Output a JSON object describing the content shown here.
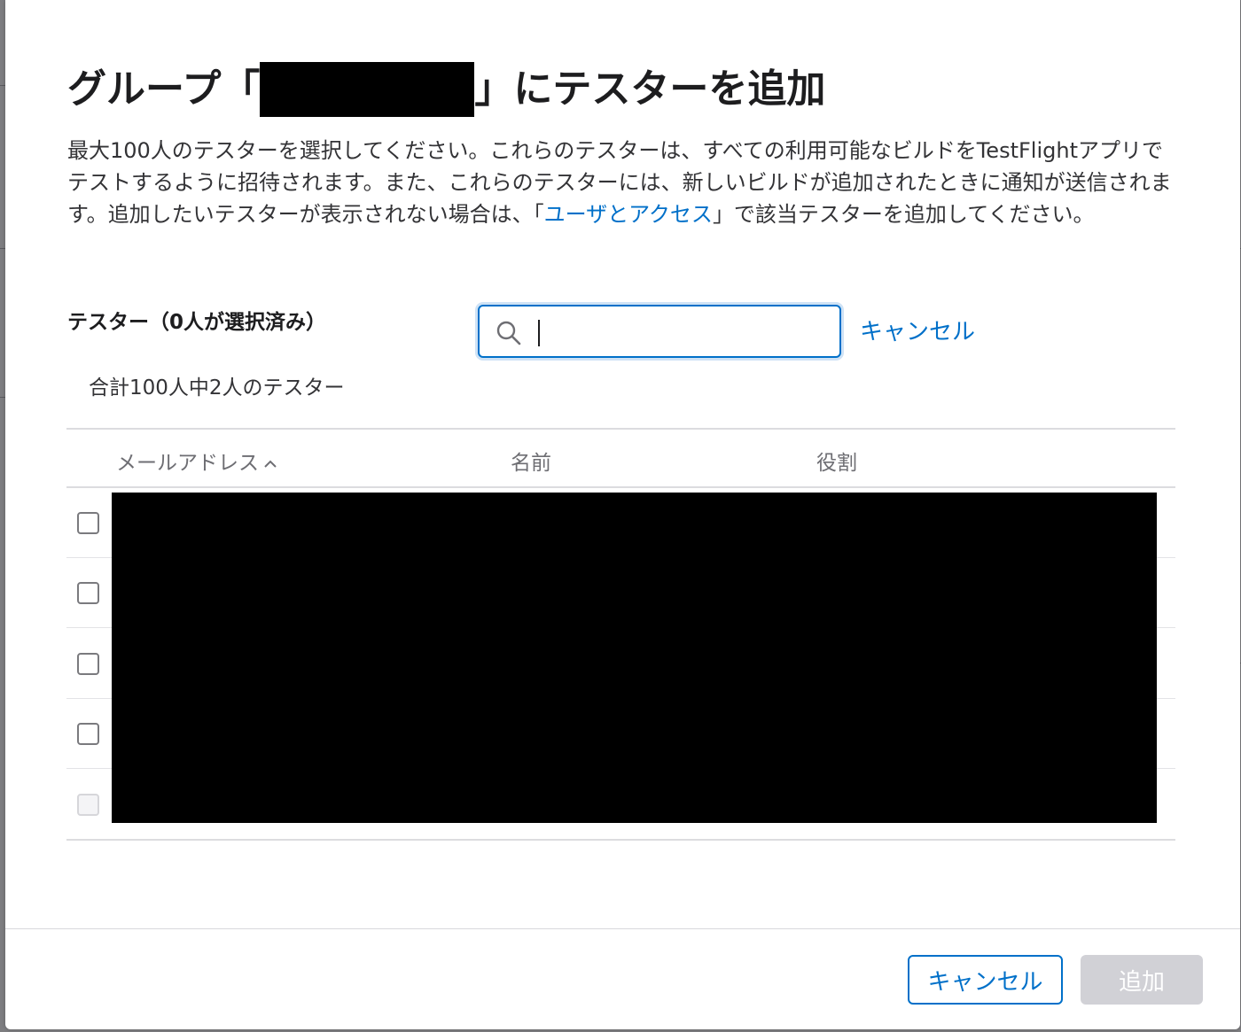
{
  "dialog": {
    "title_prefix": "グループ「",
    "title_suffix": "」にテスターを追加",
    "description_part1": "最大100人のテスターを選択してください。これらのテスターは、すべての利用可能なビルドをTestFlightアプリでテストするように招待されます。また、これらのテスターには、新しいビルドが追加されたときに通知が送信されます。追加したいテスターが表示されない場合は、「",
    "description_link": "ユーザとアクセス",
    "description_part2": "」で該当テスターを追加してください。"
  },
  "testers": {
    "label": "テスター（0人が選択済み）",
    "count_text": "合計100人中2人のテスター"
  },
  "search": {
    "value": "",
    "placeholder": "",
    "cancel_label": "キャンセル"
  },
  "table": {
    "columns": [
      "メールアドレス",
      "名前",
      "役割"
    ],
    "sort_column": "メールアドレス",
    "sort_direction": "ascending",
    "rows": [
      {
        "checked": false,
        "disabled": false
      },
      {
        "checked": false,
        "disabled": false
      },
      {
        "checked": false,
        "disabled": false
      },
      {
        "checked": false,
        "disabled": false
      },
      {
        "checked": false,
        "disabled": true
      }
    ]
  },
  "footer": {
    "cancel_label": "キャンセル",
    "add_label": "追加"
  },
  "colors": {
    "accent": "#0070c9",
    "disabled_button": "#d1d1d6",
    "title_text": "#1d1d1f"
  }
}
